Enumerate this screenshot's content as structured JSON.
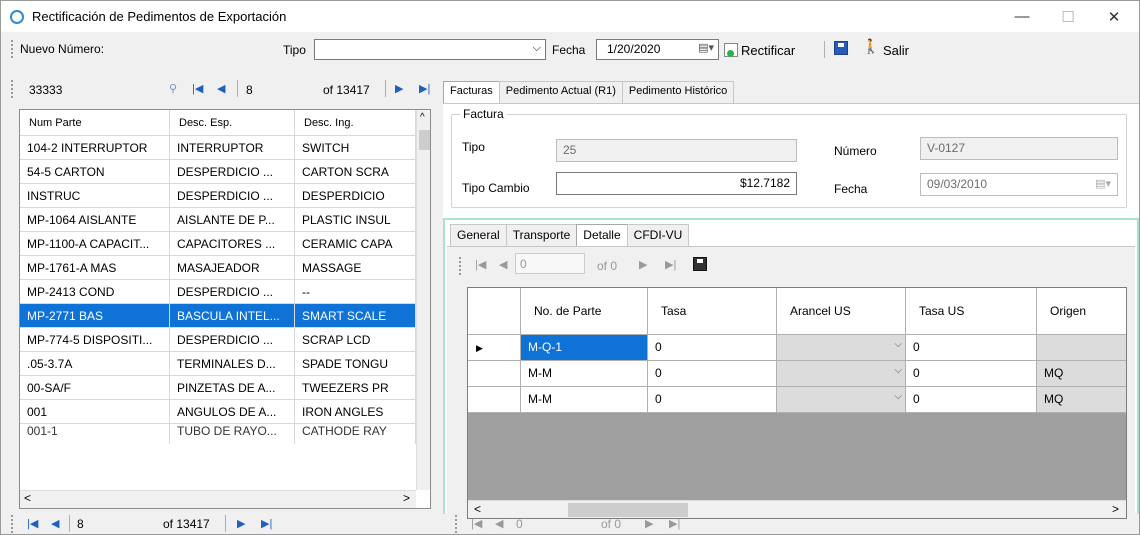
{
  "window": {
    "title": "Rectificación de Pedimentos de Exportación",
    "minimize": "—",
    "maximize": "☐",
    "close": "✕"
  },
  "toolbar": {
    "nuevo_label": "Nuevo Número:",
    "tipo_label": "Tipo",
    "tipo_value": "",
    "fecha_label": "Fecha",
    "fecha_value": "1/20/2020",
    "rectificar_label": "Rectificar",
    "salir_label": "Salir"
  },
  "nav_top": {
    "search_value": "33333",
    "position": "8",
    "total": "of 13417"
  },
  "left_grid": {
    "columns": [
      "Num Parte",
      "Desc. Esp.",
      "Desc. Ing."
    ],
    "rows": [
      [
        "104-2 INTERRUPTOR",
        "INTERRUPTOR",
        "SWITCH"
      ],
      [
        "54-5 CARTON",
        "DESPERDICIO ...",
        "CARTON SCRA"
      ],
      [
        "INSTRUC",
        "DESPERDICIO ...",
        "DESPERDICIO"
      ],
      [
        "MP-1064 AISLANTE",
        "AISLANTE DE P...",
        "PLASTIC INSUL"
      ],
      [
        "MP-1100-A CAPACIT...",
        "CAPACITORES ...",
        "CERAMIC CAPA"
      ],
      [
        "MP-1761-A MAS",
        "MASAJEADOR",
        "MASSAGE"
      ],
      [
        "MP-2413 COND",
        "DESPERDICIO ...",
        "--"
      ],
      [
        "MP-2771 BAS",
        "BASCULA INTEL...",
        "SMART SCALE"
      ],
      [
        "MP-774-5 DISPOSITI...",
        "DESPERDICIO ...",
        "SCRAP LCD"
      ],
      [
        ".05-3.7A",
        "TERMINALES D...",
        "SPADE TONGU"
      ],
      [
        "00-SA/F",
        "PINZETAS DE A...",
        "TWEEZERS PR"
      ],
      [
        "001",
        "ANGULOS DE A...",
        "IRON ANGLES"
      ],
      [
        "001-1",
        "TUBO DE RAYO...",
        "CATHODE RAY"
      ]
    ]
  },
  "nav_bottom": {
    "position": "8",
    "total": "of 13417"
  },
  "tabs_main": [
    "Facturas",
    "Pedimento Actual (R1)",
    "Pedimento Histórico"
  ],
  "factura": {
    "group_title": "Factura",
    "tipo_label": "Tipo",
    "tipo_value": "25",
    "numero_label": "Número",
    "numero_value": "V-0127",
    "tipo_cambio_label": "Tipo Cambio",
    "tipo_cambio_value": "$12.7182",
    "fecha_label": "Fecha",
    "fecha_value": "09/03/2010"
  },
  "tabs_detail": [
    "General",
    "Transporte",
    "Detalle",
    "CFDI-VU"
  ],
  "detail_nav": {
    "position": "0",
    "total": "of 0"
  },
  "detail_grid": {
    "columns": [
      "No. de Parte",
      "Tasa",
      "Arancel US",
      "Tasa US",
      "Origen"
    ],
    "rows": [
      [
        "M-Q-1",
        "0",
        "",
        "0",
        ""
      ],
      [
        "M-M",
        "0",
        "",
        "0",
        "MQ"
      ],
      [
        "M-M",
        "0",
        "",
        "0",
        "MQ"
      ]
    ]
  },
  "bottom_nav2": {
    "position": "0",
    "total": "of 0"
  }
}
